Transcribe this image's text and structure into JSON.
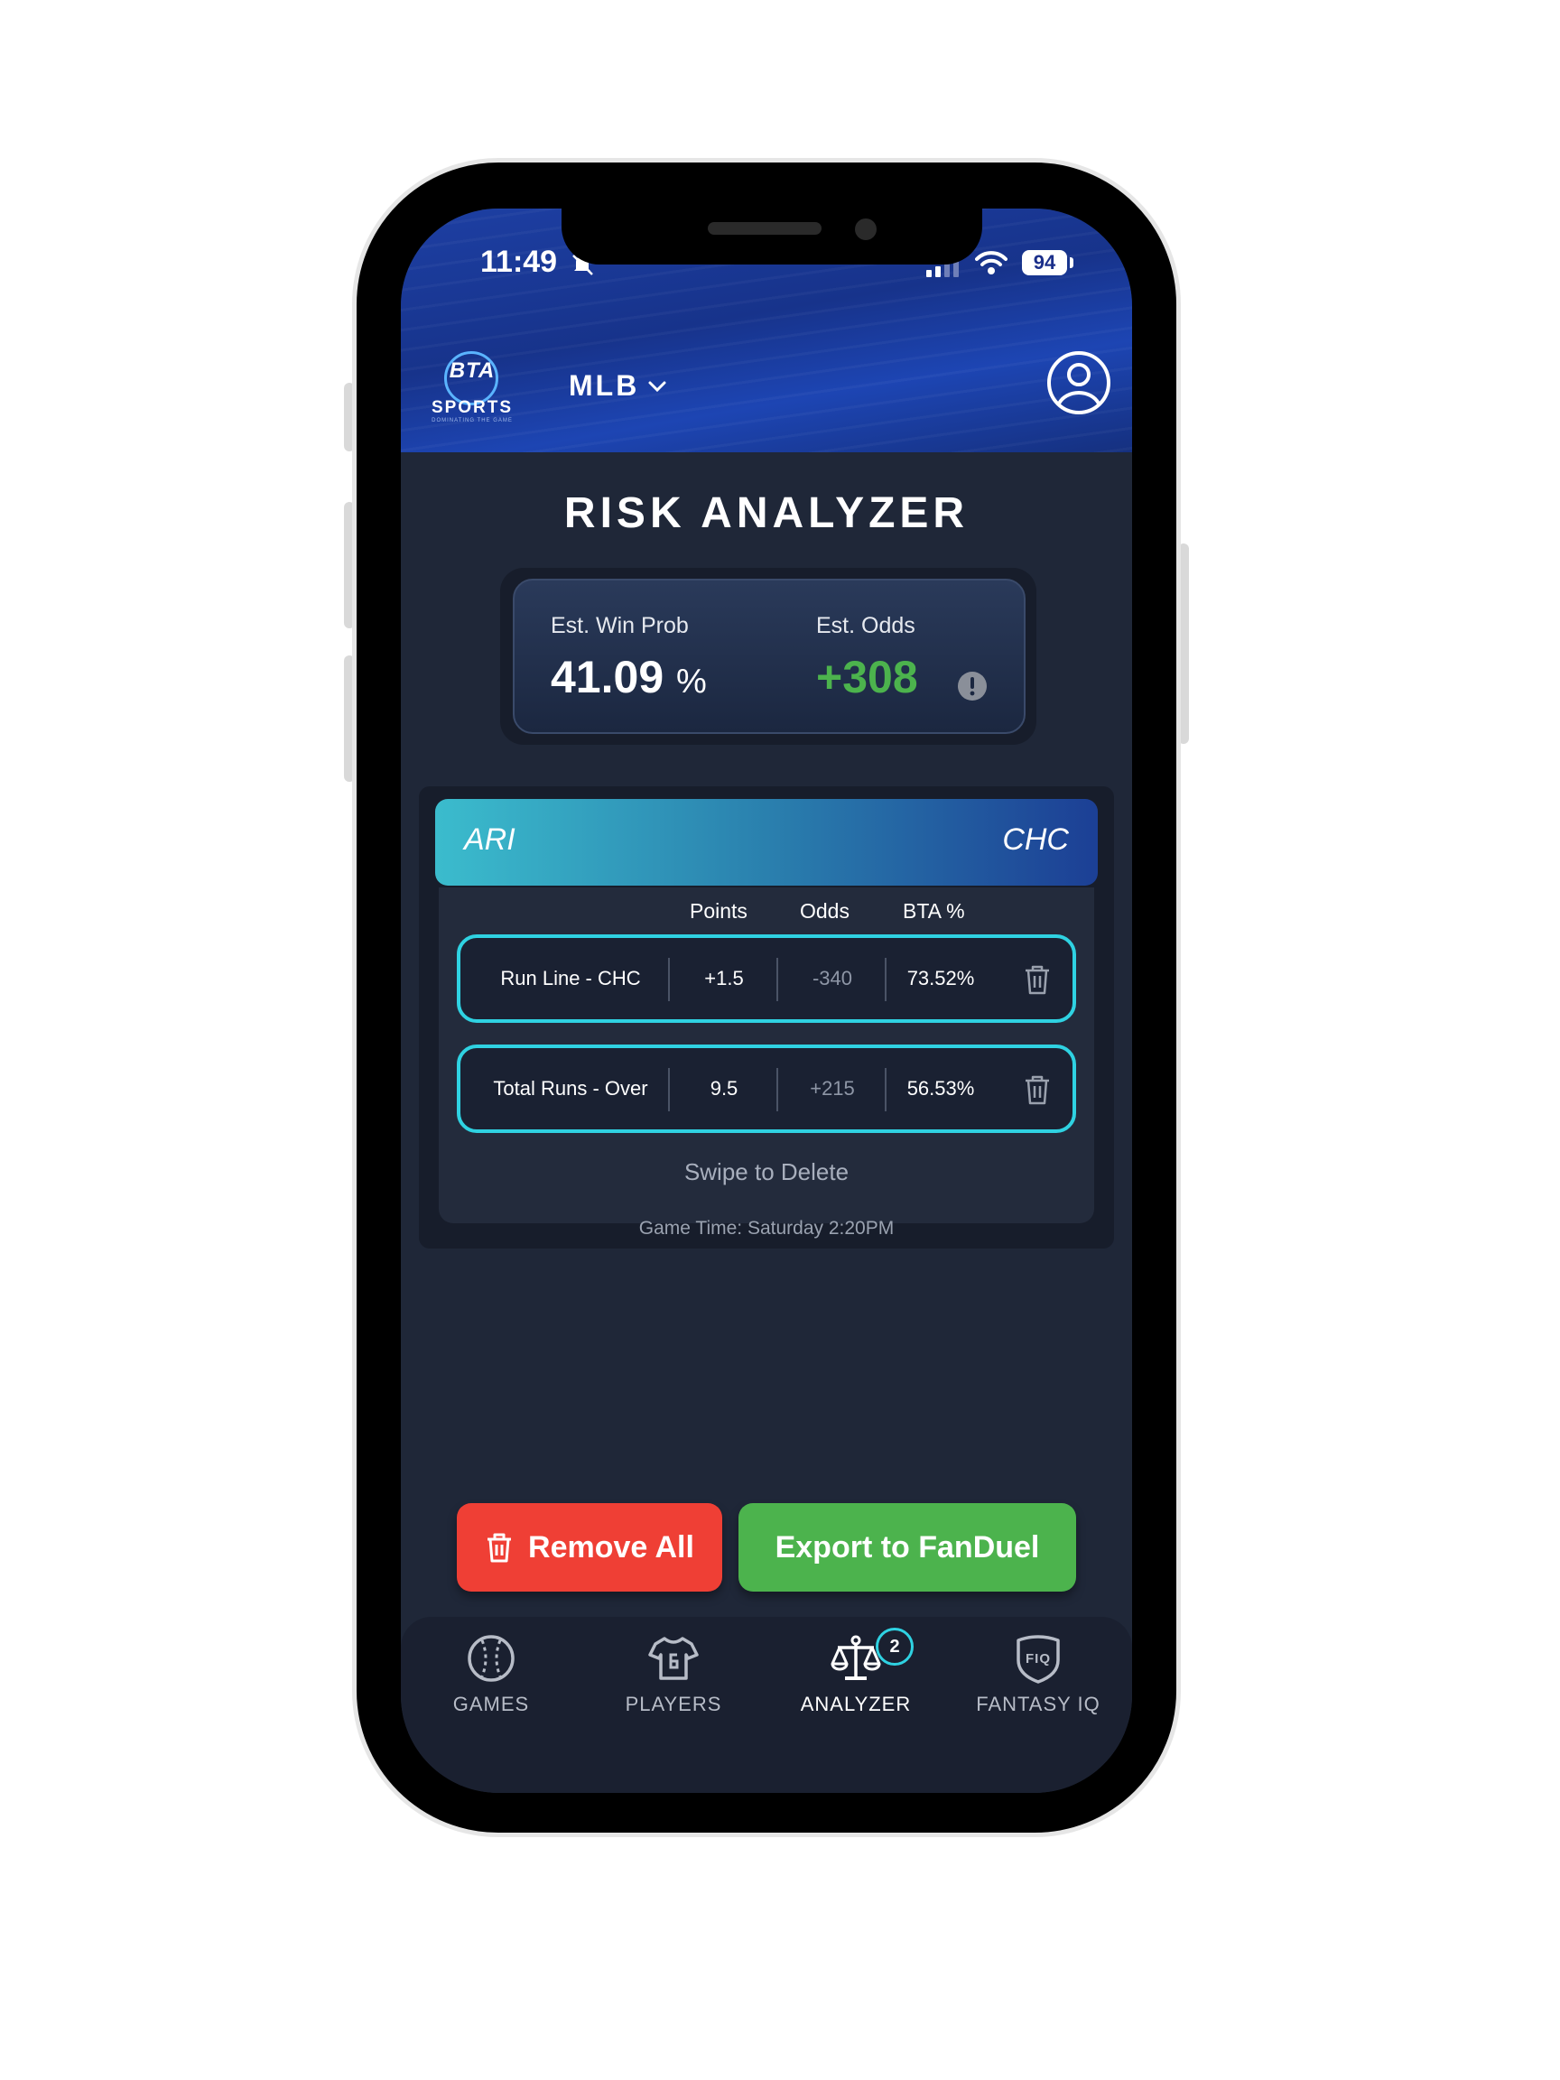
{
  "status_bar": {
    "time": "11:49",
    "battery": "94"
  },
  "header": {
    "logo": {
      "brand": "BTA",
      "sub": "SPORTS",
      "tagline": "DOMINATING THE GAME"
    },
    "league": "MLB"
  },
  "page_title": "RISK ANALYZER",
  "summary": {
    "win_prob_label": "Est. Win Prob",
    "win_prob_value": "41.09",
    "win_prob_unit": "%",
    "odds_label": "Est. Odds",
    "odds_value": "+308"
  },
  "game": {
    "away_team": "ARI",
    "home_team": "CHC",
    "columns": [
      "Points",
      "Odds",
      "BTA %"
    ],
    "bets": [
      {
        "market": "Run Line - CHC",
        "points": "+1.5",
        "odds": "-340",
        "bta_pct": "73.52%"
      },
      {
        "market": "Total Runs - Over",
        "points": "9.5",
        "odds": "+215",
        "bta_pct": "56.53%"
      }
    ],
    "swipe_hint": "Swipe to Delete",
    "game_time": "Game Time: Saturday 2:20PM"
  },
  "actions": {
    "remove_all": "Remove All",
    "export": "Export to FanDuel"
  },
  "nav": {
    "items": [
      {
        "label": "GAMES",
        "icon": "baseball-icon"
      },
      {
        "label": "PLAYERS",
        "icon": "jersey-icon"
      },
      {
        "label": "ANALYZER",
        "icon": "scale-icon"
      },
      {
        "label": "FANTASY IQ",
        "icon": "fiq-shield-icon"
      }
    ],
    "analyzer_badge": "2",
    "fiq_text": "FIQ"
  },
  "colors": {
    "accent_cyan": "#2fd2e2",
    "odds_green": "#4cb34d",
    "remove_red": "#ef3f35",
    "header_blue": "#1d3fa3",
    "background": "#1f2738"
  }
}
